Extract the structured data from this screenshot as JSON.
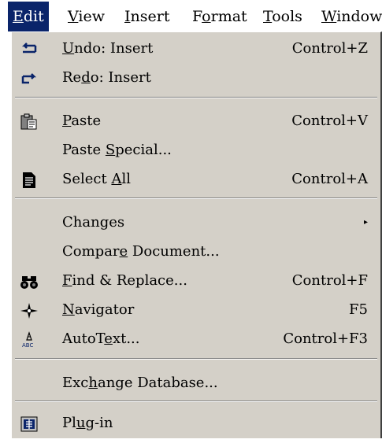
{
  "menubar": {
    "items": [
      {
        "label": "Edit",
        "mnemonic_prefix": "",
        "mnemonic": "E",
        "rest": "dit"
      },
      {
        "label": "View",
        "mnemonic_prefix": "",
        "mnemonic": "V",
        "rest": "iew"
      },
      {
        "label": "Insert",
        "mnemonic_prefix": "",
        "mnemonic": "I",
        "rest": "nsert"
      },
      {
        "label": "Format",
        "mnemonic_prefix": "F",
        "mnemonic": "o",
        "rest": "rmat"
      },
      {
        "label": "Tools",
        "mnemonic_prefix": "",
        "mnemonic": "T",
        "rest": "ools"
      },
      {
        "label": "Window",
        "mnemonic_prefix": "",
        "mnemonic": "W",
        "rest": "indow"
      }
    ]
  },
  "edit_menu": {
    "items": [
      {
        "pre": "",
        "mn": "U",
        "post": "ndo: Insert",
        "shortcut": "Control+Z",
        "icon": "undo-icon"
      },
      {
        "pre": "Re",
        "mn": "d",
        "post": "o: Insert",
        "shortcut": "",
        "icon": "redo-icon"
      },
      {
        "pre": "",
        "mn": "P",
        "post": "aste",
        "shortcut": "Control+V",
        "icon": "paste-icon"
      },
      {
        "pre": "Paste ",
        "mn": "S",
        "post": "pecial...",
        "shortcut": "",
        "icon": ""
      },
      {
        "pre": "Select ",
        "mn": "A",
        "post": "ll",
        "shortcut": "Control+A",
        "icon": "select-all-icon"
      },
      {
        "pre": "Changes",
        "mn": "",
        "post": "",
        "shortcut": "",
        "icon": "",
        "submenu": true
      },
      {
        "pre": "Compar",
        "mn": "e",
        "post": " Document...",
        "shortcut": "",
        "icon": ""
      },
      {
        "pre": "",
        "mn": "F",
        "post": "ind & Replace...",
        "shortcut": "Control+F",
        "icon": "binoculars-icon"
      },
      {
        "pre": "",
        "mn": "N",
        "post": "avigator",
        "shortcut": "F5",
        "icon": "navigator-icon"
      },
      {
        "pre": "AutoT",
        "mn": "e",
        "post": "xt...",
        "shortcut": "Control+F3",
        "icon": "autotext-icon"
      },
      {
        "pre": "Exc",
        "mn": "h",
        "post": "ange Database...",
        "shortcut": "",
        "icon": ""
      },
      {
        "pre": "Pl",
        "mn": "u",
        "post": "g-in",
        "shortcut": "",
        "icon": "plugin-icon"
      }
    ],
    "submenu_arrow": "▸"
  }
}
